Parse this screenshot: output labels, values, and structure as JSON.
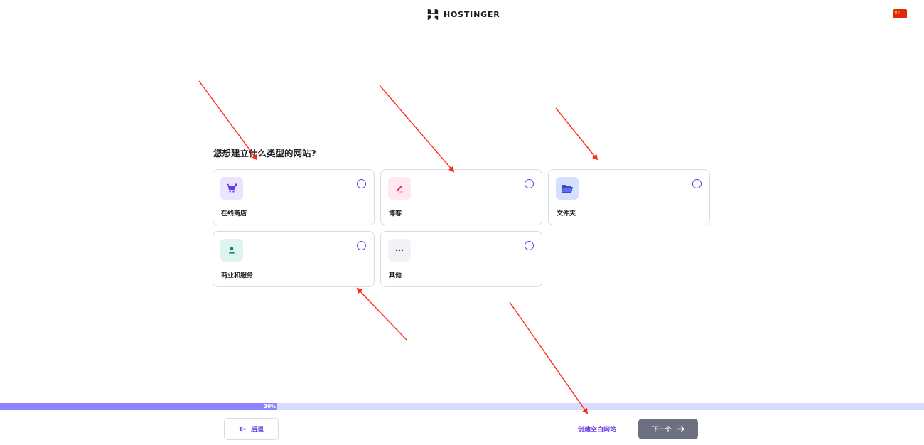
{
  "header": {
    "brand": "HOSTINGER",
    "language_flag": "china-flag-icon"
  },
  "question": "您想建立什么类型的网站?",
  "options": [
    {
      "label": "在线商店",
      "icon": "shopping-cart-icon",
      "icon_bg": "#ebe4ff",
      "icon_color": "#673de6",
      "selected": false
    },
    {
      "label": "博客",
      "icon": "pencil-icon",
      "icon_bg": "#ffe8ef",
      "icon_color": "#d63163",
      "selected": false
    },
    {
      "label": "文件夹",
      "icon": "folder-icon",
      "icon_bg": "#d5dfff",
      "icon_color": "#3c4ac6",
      "selected": false
    },
    {
      "label": "商业和服务",
      "icon": "person-icon",
      "icon_bg": "#def4f0",
      "icon_color": "#008361",
      "selected": false
    },
    {
      "label": "其他",
      "icon": "more-dots-icon",
      "icon_bg": "#f2f3f6",
      "icon_color": "#36344d",
      "selected": false
    }
  ],
  "progress": {
    "percent": 30,
    "label": "30%"
  },
  "footer": {
    "back_label": "后退",
    "create_empty_label": "创建空白网站",
    "next_label": "下一个"
  },
  "colors": {
    "accent": "#673de6",
    "progress_fill": "#8c85ff",
    "progress_track": "#d9dcfc",
    "next_button": "#6d7081",
    "annotation_arrow": "#ff2a1a"
  }
}
